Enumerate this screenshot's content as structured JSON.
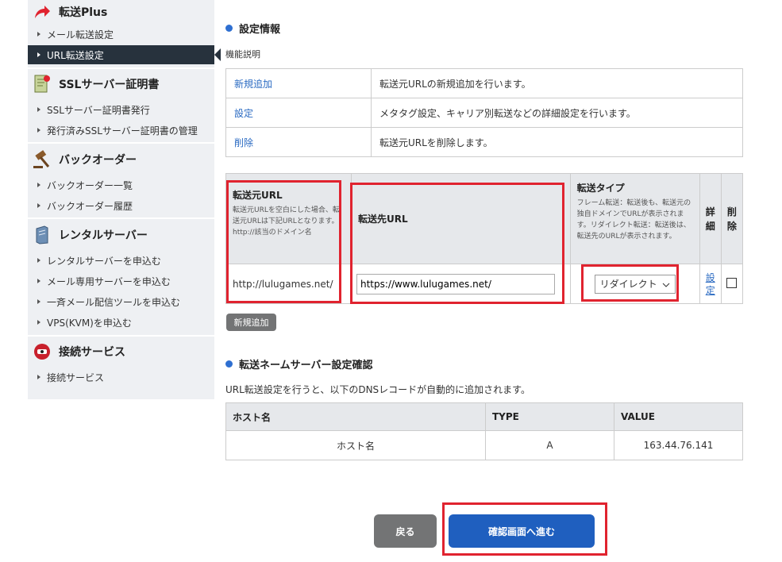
{
  "sidebar": {
    "sections": [
      {
        "title": "転送Plus",
        "icon": "arrow-forward-icon",
        "items": [
          "メール転送設定",
          "URL転送設定"
        ]
      },
      {
        "title": "SSLサーバー証明書",
        "icon": "certificate-icon",
        "items": [
          "SSLサーバー証明書発行",
          "発行済みSSLサーバー証明書の管理"
        ]
      },
      {
        "title": "バックオーダー",
        "icon": "gavel-icon",
        "items": [
          "バックオーダー一覧",
          "バックオーダー履歴"
        ]
      },
      {
        "title": "レンタルサーバー",
        "icon": "server-icon",
        "items": [
          "レンタルサーバーを申込む",
          "メール専用サーバーを申込む",
          "一斉メール配信ツールを申込む",
          "VPS(KVM)を申込む"
        ]
      },
      {
        "title": "接続サービス",
        "icon": "connection-icon",
        "items": [
          "接続サービス"
        ]
      }
    ]
  },
  "settings": {
    "heading": "設定情報",
    "subheading": "機能説明",
    "rows": [
      {
        "key": "新規追加",
        "desc": "転送元URLの新規追加を行います。"
      },
      {
        "key": "設定",
        "desc": "メタタグ設定、キャリア別転送などの詳細設定を行います。"
      },
      {
        "key": "削除",
        "desc": "転送元URLを削除します。"
      }
    ]
  },
  "forward": {
    "col_source": "転送元URL",
    "col_source_note": "転送元URLを空白にした場合、転送元URLは下記URLとなります。http://該当のドメイン名",
    "col_dest": "転送先URL",
    "col_type": "転送タイプ",
    "col_type_note": "フレーム転送：転送後も、転送元の独自ドメインでURLが表示されます。リダイレクト転送：転送後は、転送先のURLが表示されます。",
    "col_detail": "詳細",
    "col_delete": "削除",
    "source_url": "http://lulugames.net/",
    "dest_url": "https://www.lulugames.net/",
    "type_value": "リダイレクト",
    "detail_link": "設定",
    "add_button": "新規追加"
  },
  "dns": {
    "heading": "転送ネームサーバー設定確認",
    "note": "URL転送設定を行うと、以下のDNSレコードが自動的に追加されます。",
    "headers": [
      "ホスト名",
      "TYPE",
      "VALUE"
    ],
    "row": [
      "ホスト名",
      "A",
      "163.44.76.141"
    ]
  },
  "buttons": {
    "back": "戻る",
    "confirm": "確認画面へ進む"
  }
}
